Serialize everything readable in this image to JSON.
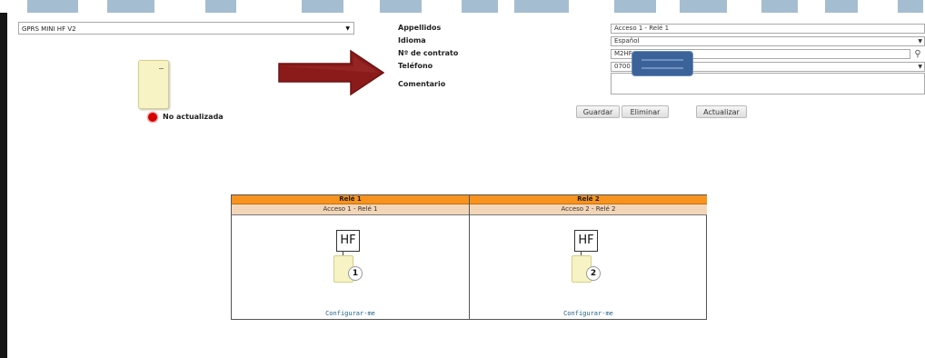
{
  "device_select": {
    "value": "GPRS MINI HF V2"
  },
  "status": {
    "text": "No actualizada",
    "color": "#d50000"
  },
  "form": {
    "labels": {
      "apellidos": "Appellidos",
      "idioma": "Idioma",
      "contrato": "Nº de contrato",
      "telefono": "Teléfono",
      "comentario": "Comentario"
    },
    "values": {
      "apellidos": "Acceso 1 - Relé 1",
      "idioma": "Español",
      "contrato": "M2HF",
      "telefono": "0700"
    }
  },
  "buttons": {
    "guardar": "Guardar",
    "eliminar": "Eliminar",
    "actualizar": "Actualizar"
  },
  "relays": [
    {
      "title": "Relé 1",
      "subtitle": "Acceso 1 - Relé 1",
      "device_label": "HF",
      "number": "1",
      "link": "Configurar-me"
    },
    {
      "title": "Relé 2",
      "subtitle": "Acceso 2 - Relé 2",
      "device_label": "HF",
      "number": "2",
      "link": "Configurar-me"
    }
  ],
  "colors": {
    "relay_header": "#f7931e",
    "relay_subheader": "#f3d6b8",
    "arrow": "#8b1a1a",
    "redaction": "#3c6399"
  },
  "icons": {
    "search": "magnifier-icon",
    "dropdown": "caret-down-icon"
  }
}
